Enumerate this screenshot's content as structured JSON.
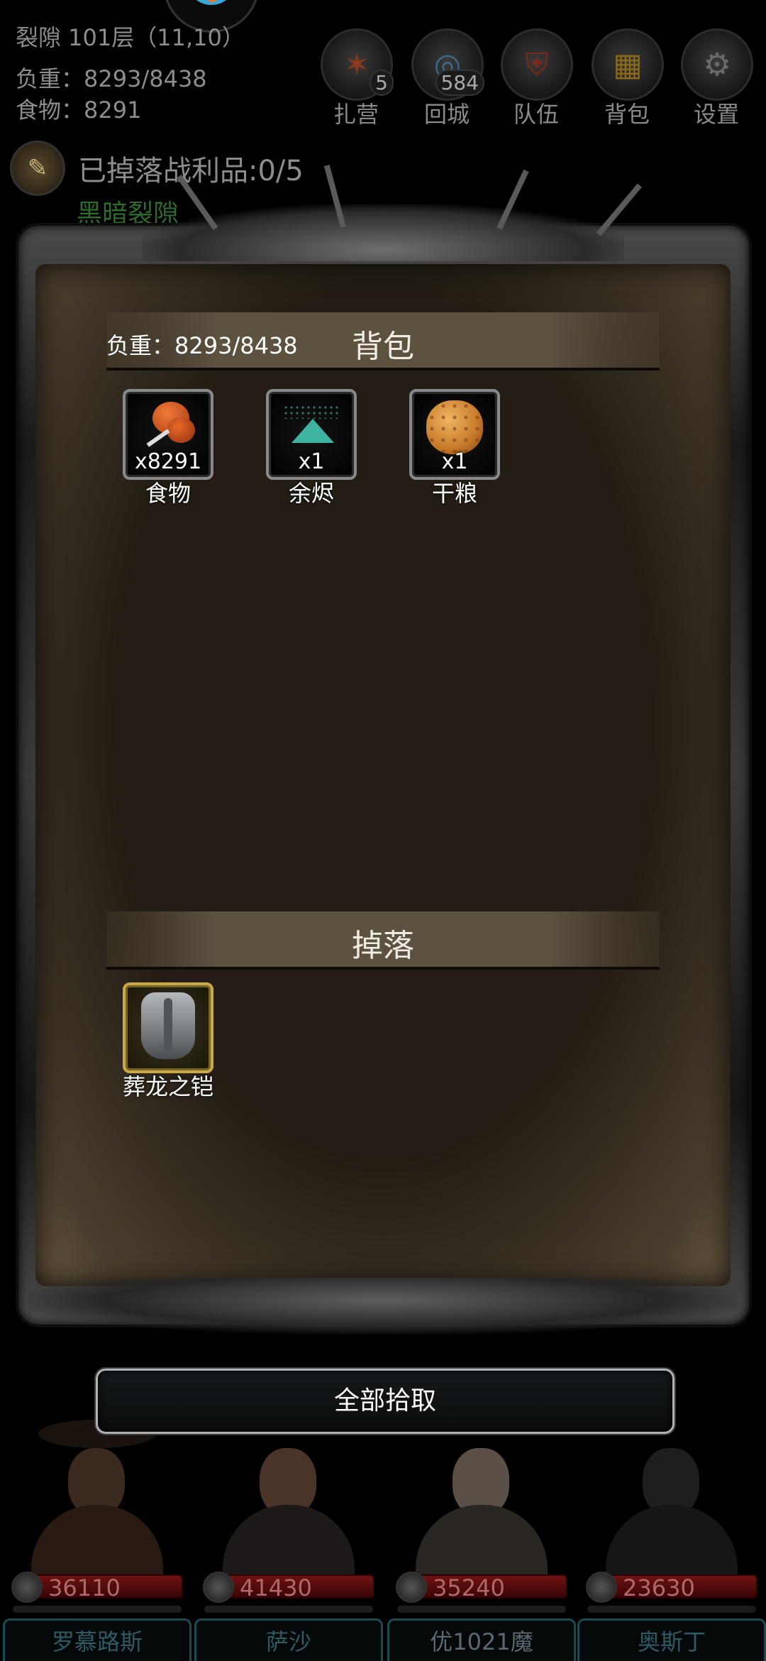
{
  "hud": {
    "location": "裂隙 101层（11,10）",
    "weight": "负重：8293/8438",
    "food": "食物：8291"
  },
  "nav": [
    {
      "label": "扎营",
      "badge": "5",
      "icon": "campfire-icon"
    },
    {
      "label": "回城",
      "badge": "584",
      "icon": "portal-icon"
    },
    {
      "label": "队伍",
      "badge": "",
      "icon": "shield-icon"
    },
    {
      "label": "背包",
      "badge": "",
      "icon": "chest-icon"
    },
    {
      "label": "设置",
      "badge": "",
      "icon": "gear-icon"
    }
  ],
  "loot_status": "已掉落战利品:0/5",
  "hidden_quest": "黑暗裂隙",
  "panel": {
    "weight": "负重：8293/8438",
    "bag_title": "背包",
    "drop_title": "掉落",
    "bag_items": [
      {
        "name": "食物",
        "qty": "x8291",
        "icon": "drumstick-icon"
      },
      {
        "name": "余烬",
        "qty": "x1",
        "icon": "ember-icon"
      },
      {
        "name": "干粮",
        "qty": "x1",
        "icon": "biscuit-icon"
      }
    ],
    "drop_items": [
      {
        "name": "葬龙之铠",
        "qty": "",
        "icon": "armor-icon",
        "rarity_color": "#c8a84a"
      }
    ]
  },
  "pick_all_label": "全部拾取",
  "heroes": [
    {
      "name": "罗慕路斯",
      "hp": "36110"
    },
    {
      "name": "萨沙",
      "hp": "41430"
    },
    {
      "name": "优1021魔",
      "hp": "35240"
    },
    {
      "name": "奥斯丁",
      "hp": "23630"
    }
  ]
}
